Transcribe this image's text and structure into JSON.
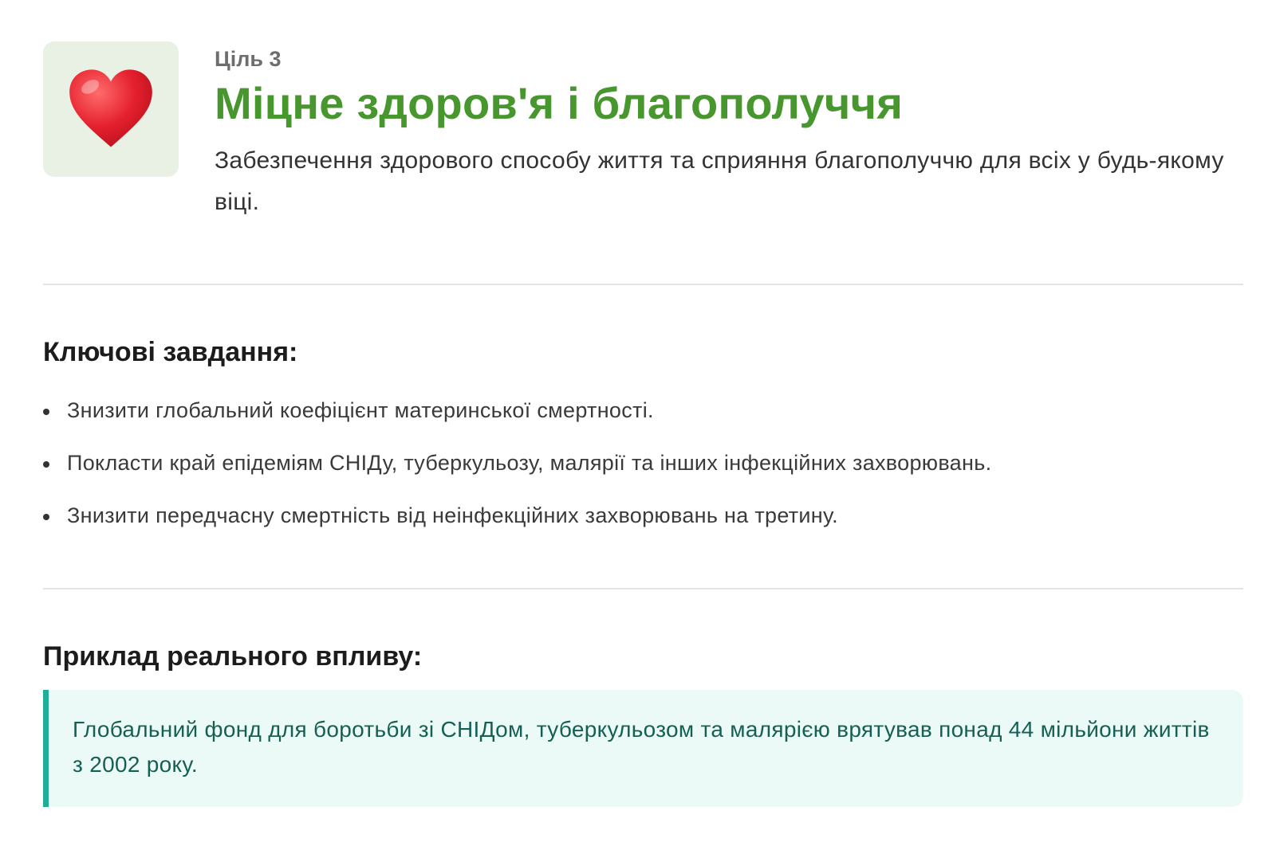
{
  "goal": {
    "icon": "heart-icon",
    "icon_color": "#e5202e",
    "label": "Ціль 3",
    "title": "Міцне здоров'я і благополуччя",
    "description": "Забезпечення здорового способу життя та сприяння благополуччю для всіх у будь-якому віці.",
    "title_color": "#48972e"
  },
  "tasks": {
    "heading": "Ключові завдання:",
    "items": [
      "Знизити глобальний коефіцієнт материнської смертності.",
      "Покласти край епідеміям СНІДу, туберкульозу, малярії та інших інфекційних захворювань.",
      "Знизити передчасну смертність від неінфекційних захворювань на третину."
    ]
  },
  "impact": {
    "heading": "Приклад реального впливу:",
    "text": "Глобальний фонд для боротьби зі СНІДом, туберкульозом та малярією врятував понад 44 мільйони життів з 2002 року.",
    "accent_color": "#1fae97"
  }
}
